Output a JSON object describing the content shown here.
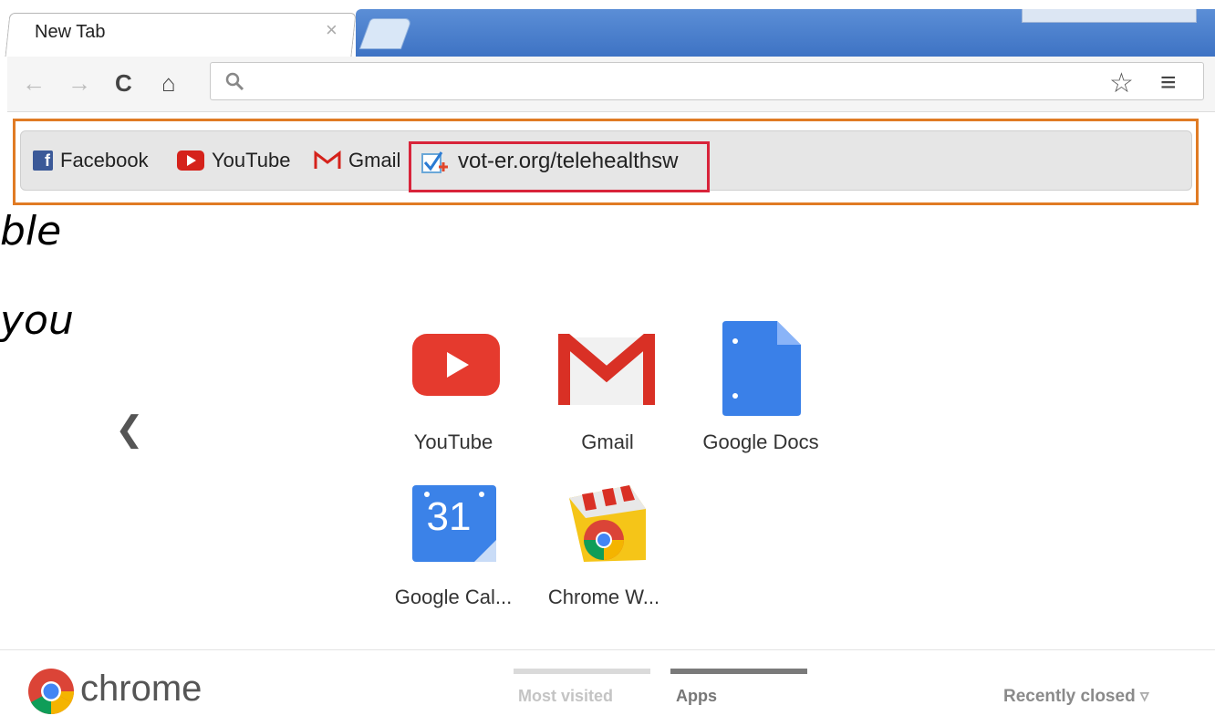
{
  "tab": {
    "title": "New Tab",
    "close": "×"
  },
  "toolbar": {
    "back": "←",
    "forward": "→",
    "reload": "C",
    "home": "⌂",
    "star": "☆",
    "menu": "≡"
  },
  "omnibox": {
    "value": "",
    "placeholder": ""
  },
  "bookmarks": [
    {
      "label": "Facebook",
      "icon": "facebook-icon"
    },
    {
      "label": "YouTube",
      "icon": "youtube-icon"
    },
    {
      "label": "Gmail",
      "icon": "gmail-icon"
    },
    {
      "label": "vot-er.org/telehealthsw",
      "icon": "checkmark-plus-icon"
    }
  ],
  "overlay_text": {
    "line1": "ble",
    "line2": "you"
  },
  "apps": {
    "prev": "❮",
    "items": [
      {
        "label": "YouTube"
      },
      {
        "label": "Gmail"
      },
      {
        "label": "Google Docs"
      },
      {
        "label": "Google Cal..."
      },
      {
        "label": "Chrome W..."
      }
    ],
    "calendar_day": "31"
  },
  "footer": {
    "logo": "chrome",
    "most_visited": "Most visited",
    "apps": "Apps",
    "recently_closed": "Recently closed",
    "recently_closed_arrow": "▿"
  },
  "colors": {
    "highlight_orange": "#e07b24",
    "highlight_red": "#d8243a",
    "tab_blue": "#4a7fcf"
  }
}
